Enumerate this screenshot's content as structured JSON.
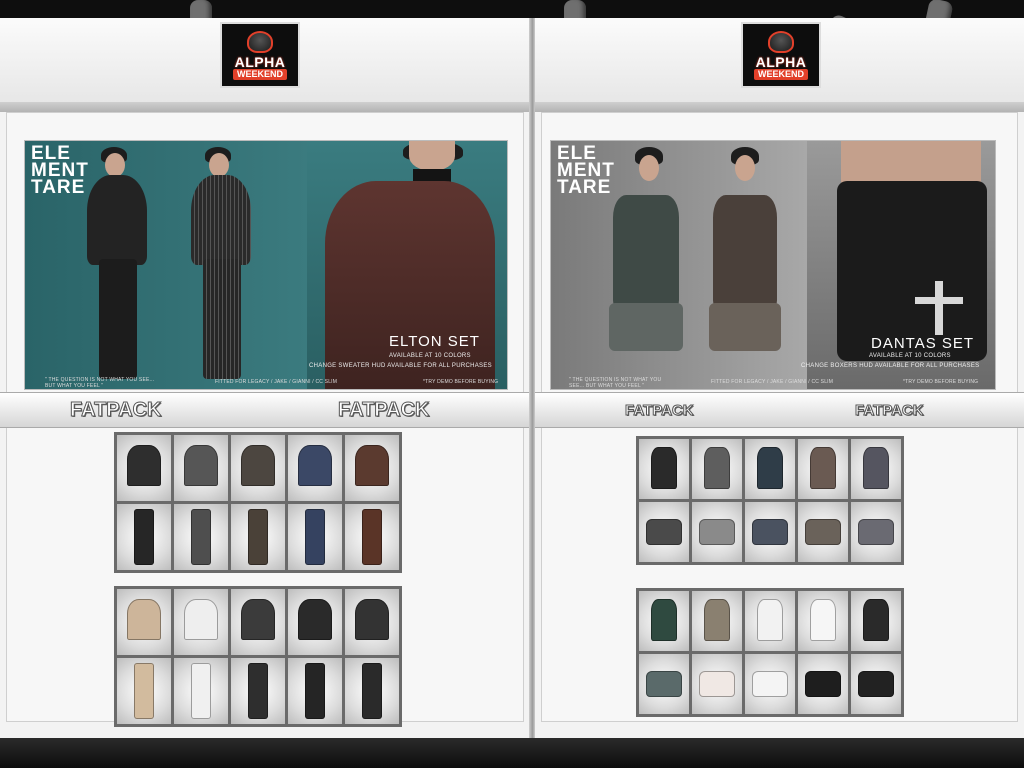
{
  "scene": {
    "colors": {
      "left_poster_bg": "#2f6a6e",
      "right_poster_bg": "#8a8a8a",
      "logo_accent": "#e2402a"
    }
  },
  "booths": {
    "left": {
      "logo": {
        "line1": "ALPHA",
        "line2": "WEEKEND",
        "small": "R6-96L"
      },
      "poster": {
        "brand": "ELE MENT TARE",
        "set_title": "ELTON SET",
        "subtitle": "AVAILABLE AT 10 COLORS",
        "note": "CHANGE SWEATER HUD AVAILABLE FOR ALL PURCHASES",
        "quote": "\" THE QUESTION IS NOT WHAT YOU SEE... BUT WHAT YOU FEEL \"",
        "fit": "FITTED FOR LEGACY / JAKE / GIANNI / CC SLIM",
        "demo": "*TRY DEMO BEFORE BUYING"
      },
      "fatpack_labels": [
        "FATPACK",
        "FATPACK"
      ],
      "grids": [
        {
          "tops": [
            {
              "item": "jacket",
              "color": "#2e2e2e"
            },
            {
              "item": "jacket",
              "color": "#565656"
            },
            {
              "item": "jacket",
              "color": "#4c4640"
            },
            {
              "item": "jacket",
              "color": "#3b4866"
            },
            {
              "item": "jacket",
              "color": "#5b3a2f"
            }
          ],
          "bottoms": [
            {
              "item": "pants",
              "color": "#262626"
            },
            {
              "item": "pants",
              "color": "#4e4e4e"
            },
            {
              "item": "pants",
              "color": "#4a4138"
            },
            {
              "item": "pants",
              "color": "#354260"
            },
            {
              "item": "pants",
              "color": "#5a3427"
            }
          ]
        },
        {
          "tops": [
            {
              "item": "jacket",
              "color": "#cdb59a"
            },
            {
              "item": "jacket",
              "color": "#eeeeee"
            },
            {
              "item": "jacket",
              "color": "#3b3b3b"
            },
            {
              "item": "jacket",
              "color": "#2a2a2a"
            },
            {
              "item": "jacket",
              "color": "#333333"
            }
          ],
          "bottoms": [
            {
              "item": "pants",
              "color": "#d2bb9e"
            },
            {
              "item": "pants",
              "color": "#f0f0f0"
            },
            {
              "item": "pants",
              "color": "#2e2e2e"
            },
            {
              "item": "pants",
              "color": "#252525"
            },
            {
              "item": "pants",
              "color": "#2a2a2a"
            }
          ]
        }
      ]
    },
    "right": {
      "logo": {
        "line1": "ALPHA",
        "line2": "WEEKEND",
        "small": "R6-96L"
      },
      "poster": {
        "brand": "ELE MENT TARE",
        "set_title": "DANTAS SET",
        "subtitle": "AVAILABLE AT 10 COLORS",
        "note": "CHANGE BOXERS HUD AVAILABLE FOR ALL PURCHASES",
        "quote": "\" THE QUESTION IS NOT WHAT YOU SEE... BUT WHAT YOU FEEL \"",
        "fit": "FITTED FOR LEGACY / JAKE / GIANNI / CC SLIM",
        "demo": "*TRY DEMO BEFORE BUYING"
      },
      "fatpack_labels": [
        "FATPACK",
        "FATPACK"
      ],
      "grids": [
        {
          "tops": [
            {
              "item": "tank",
              "color": "#2a2a2a"
            },
            {
              "item": "tank",
              "color": "#5e5e5e"
            },
            {
              "item": "tank",
              "color": "#2f3d48"
            },
            {
              "item": "tank",
              "color": "#6a5a52"
            },
            {
              "item": "tank",
              "color": "#555560"
            }
          ],
          "bottoms": [
            {
              "item": "shorts",
              "color": "#4a4a4a"
            },
            {
              "item": "shorts",
              "color": "#8a8a8a"
            },
            {
              "item": "shorts",
              "color": "#4a5260"
            },
            {
              "item": "shorts",
              "color": "#6a625a"
            },
            {
              "item": "shorts",
              "color": "#6a6a72"
            }
          ]
        },
        {
          "tops": [
            {
              "item": "tank",
              "color": "#2f4a40"
            },
            {
              "item": "tank",
              "color": "#8a8070"
            },
            {
              "item": "tank",
              "color": "#f2f2f2"
            },
            {
              "item": "tank",
              "color": "#f6f6f6"
            },
            {
              "item": "tank",
              "color": "#2a2a2a"
            }
          ],
          "bottoms": [
            {
              "item": "shorts",
              "color": "#5a6a6a"
            },
            {
              "item": "shorts",
              "color": "#f0e8e4"
            },
            {
              "item": "shorts",
              "color": "#f4f4f4"
            },
            {
              "item": "shorts",
              "color": "#1e1e1e"
            },
            {
              "item": "shorts",
              "color": "#222222"
            }
          ]
        }
      ]
    }
  }
}
